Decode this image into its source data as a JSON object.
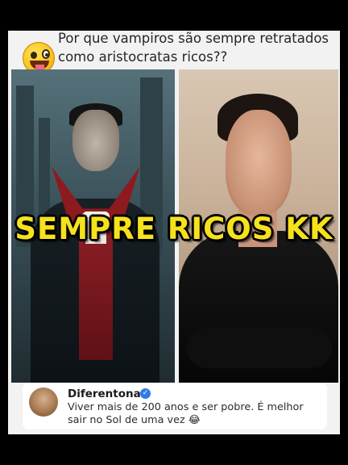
{
  "post": {
    "question": "Por que vampiros são sempre retratados como aristocratas ricos??",
    "emoji_icon": "zany-face-emoji"
  },
  "overlay": {
    "caption": "SEMPRE RICOS KK",
    "color": "#f6e21c"
  },
  "comment": {
    "username": "Diferentona",
    "verified": true,
    "text": "Viver mais de 200 anos e ser pobre. É melhor sair no Sol de uma vez 😂",
    "verified_color": "#2f7be8"
  }
}
